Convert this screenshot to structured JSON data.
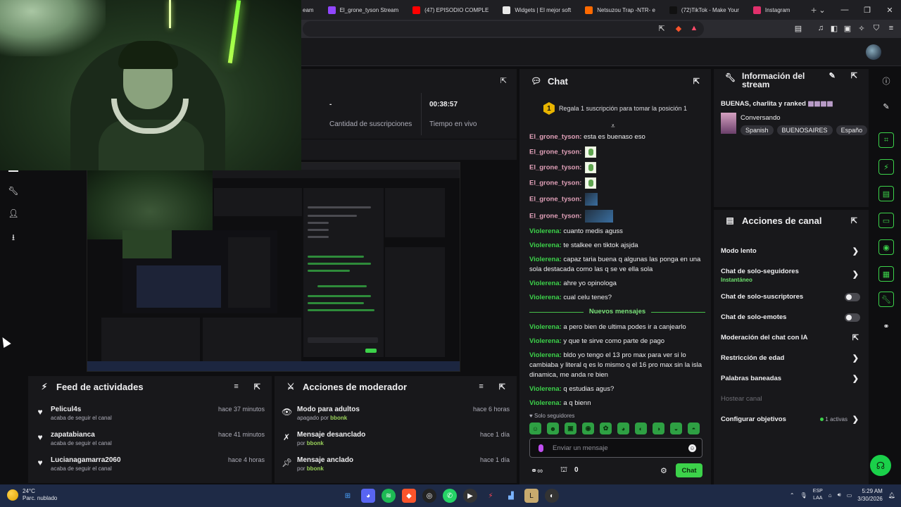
{
  "browser": {
    "tabs": [
      {
        "label": "eam",
        "color": "#9146ff"
      },
      {
        "label": "El_grone_tyson Stream",
        "color": "#9146ff"
      },
      {
        "label": "(47) EPISODIO COMPLE",
        "color": "#ff0000"
      },
      {
        "label": "Widgets | El mejor soft",
        "color": "#e8e8e8"
      },
      {
        "label": "Netsuzou Trap -NTR- e",
        "color": "#ff6a00"
      },
      {
        "label": "(72)TikTok - Make Your",
        "color": "#111111"
      },
      {
        "label": "Instagram",
        "color": "#e1306c"
      }
    ],
    "new_tab": "+",
    "window_controls": [
      "⌄",
      "—",
      "❐",
      "✕"
    ]
  },
  "stats": {
    "subs_value": "-",
    "subs_label": "Cantidad de suscripciones",
    "live_value": "00:38:57",
    "live_label": "Tiempo en vivo"
  },
  "feed": {
    "title": "Feed de actividades",
    "items": [
      {
        "name": "Pelicul4s",
        "sub": "acaba de seguir el canal",
        "time": "hace 37 minutos"
      },
      {
        "name": "zapatabianca",
        "sub": "acaba de seguir el canal",
        "time": "hace 41 minutos"
      },
      {
        "name": "Lucianagamarra2060",
        "sub": "acaba de seguir el canal",
        "time": "hace 4 horas"
      }
    ]
  },
  "mod_actions": {
    "title": "Acciones de moderador",
    "items": [
      {
        "name": "Modo para adultos",
        "sub_prefix": "apagado por",
        "by": "bbonk",
        "time": "hace 6 horas",
        "icon": "eye-icon"
      },
      {
        "name": "Mensaje desanclado",
        "sub_prefix": "por",
        "by": "bbonk",
        "time": "hace 1 día",
        "icon": "unpin-icon"
      },
      {
        "name": "Mensaje anclado",
        "sub_prefix": "por",
        "by": "bbonk",
        "time": "hace 1 día",
        "icon": "pin-icon"
      }
    ]
  },
  "chat": {
    "title": "Chat",
    "pinned_rank": "1",
    "pinned_text": "Regala 1 suscripción para tomar la posición 1",
    "messages": [
      {
        "user": "El_grone_tyson:",
        "text": "esta es buenaso eso",
        "color": "#e0a0b8",
        "emote": ""
      },
      {
        "user": "El_grone_tyson:",
        "text": "",
        "color": "#e0a0b8",
        "emote": "green"
      },
      {
        "user": "El_grone_tyson:",
        "text": "",
        "color": "#e0a0b8",
        "emote": "green"
      },
      {
        "user": "El_grone_tyson:",
        "text": "",
        "color": "#e0a0b8",
        "emote": "green"
      },
      {
        "user": "El_grone_tyson:",
        "text": "",
        "color": "#e0a0b8",
        "emote": "blue"
      },
      {
        "user": "El_grone_tyson:",
        "text": "",
        "color": "#e0a0b8",
        "emote": "bluewide"
      },
      {
        "user": "Violerena:",
        "text": "cuanto medis aguss",
        "color": "#3cd24a",
        "emote": ""
      },
      {
        "user": "Violerena:",
        "text": "te stalkee en tiktok ajsjda",
        "color": "#3cd24a",
        "emote": ""
      },
      {
        "user": "Violerena:",
        "text": "capaz taria buena q algunas las ponga en una sola destacada como las q se ve ella sola",
        "color": "#3cd24a",
        "emote": ""
      },
      {
        "user": "Violerena:",
        "text": "ahre yo opinologa",
        "color": "#3cd24a",
        "emote": ""
      },
      {
        "user": "Violerena:",
        "text": "cual celu tenes?",
        "color": "#3cd24a",
        "emote": ""
      }
    ],
    "new_messages_label": "Nuevos mensajes",
    "new_messages": [
      {
        "user": "Violerena:",
        "text": "a pero bien de ultima podes ir a canjearlo",
        "color": "#3cd24a"
      },
      {
        "user": "Violerena:",
        "text": "y que te sirve como parte de pago",
        "color": "#3cd24a"
      },
      {
        "user": "Violerena:",
        "text": "bldo yo tengo el 13 pro max para ver si lo cambiaba y literal q es lo mismo q el 16 pro max sin la isla dinamica, me anda re bien",
        "color": "#3cd24a"
      },
      {
        "user": "Violerena:",
        "text": "q estudias agus?",
        "color": "#3cd24a"
      },
      {
        "user": "Violerena:",
        "text": "a q bienn",
        "color": "#3cd24a"
      }
    ],
    "solo_seguidores": "Solo seguidores",
    "placeholder": "Enviar un mensaje",
    "points": "0",
    "send_label": "Chat"
  },
  "info": {
    "title": "Información del stream",
    "stream_title": "BUENAS, charlita y ranked",
    "category": "Conversando",
    "tags": [
      "Spanish",
      "BUENOSAIRES",
      "Españo"
    ]
  },
  "acciones": {
    "title": "Acciones de canal",
    "rows": [
      {
        "label": "Modo lento",
        "kind": "chev"
      },
      {
        "label": "Chat de solo-seguidores",
        "kind": "chev",
        "sub": "Instantáneo"
      },
      {
        "label": "Chat de solo-suscriptores",
        "kind": "toggle"
      },
      {
        "label": "Chat de solo-emotes",
        "kind": "toggle"
      },
      {
        "label": "Moderación del chat con IA",
        "kind": "ext"
      },
      {
        "label": "Restricción de edad",
        "kind": "chev"
      },
      {
        "label": "Palabras baneadas",
        "kind": "chev"
      },
      {
        "label": "Hostear canal",
        "kind": "dim"
      },
      {
        "label": "Configurar objetivos",
        "kind": "chev",
        "extra": "1 activas"
      }
    ]
  },
  "taskbar": {
    "temp": "24°C",
    "weather": "Parc. nublado",
    "lang_top": "ESP",
    "lang_bottom": "LAA",
    "time": "5:29 AM",
    "date": "3/30/2026"
  }
}
